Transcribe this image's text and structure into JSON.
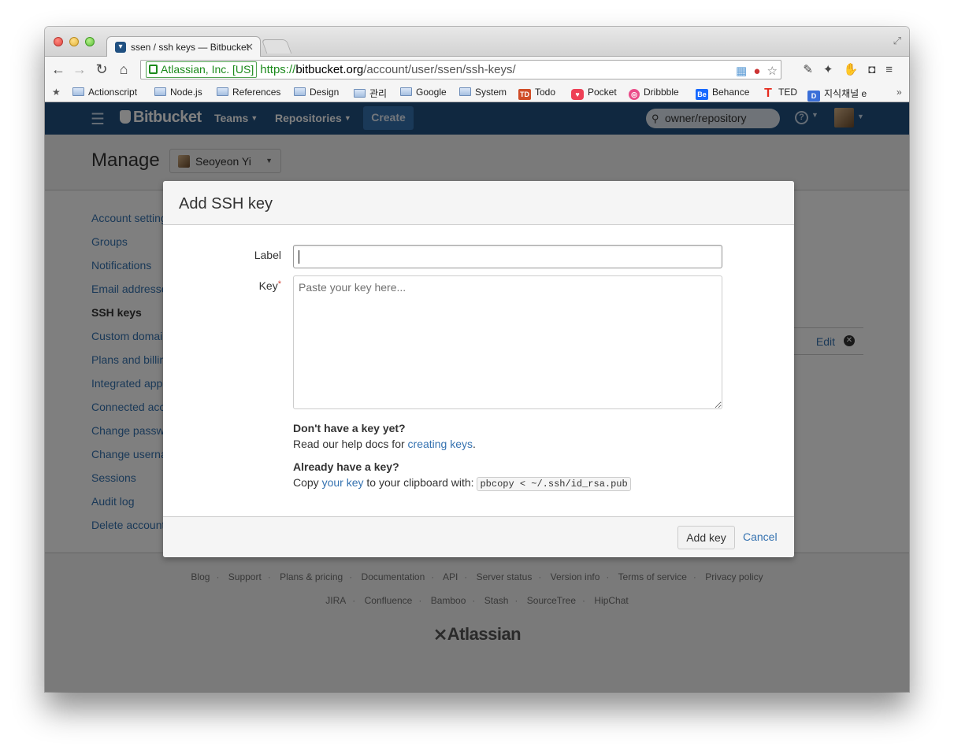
{
  "browser": {
    "tab_title": "ssen / ssh keys — Bitbucket",
    "ev_org": "Atlassian, Inc. [US]",
    "url_scheme": "https://",
    "url_host": "bitbucket.org",
    "url_path": "/account/user/ssen/ssh-keys/",
    "bookmarks": [
      {
        "label": "Actionscript",
        "icon": "folder-icon"
      },
      {
        "label": "Node.js",
        "icon": "folder-icon"
      },
      {
        "label": "References",
        "icon": "folder-icon"
      },
      {
        "label": "Design",
        "icon": "folder-icon"
      },
      {
        "label": "관리",
        "icon": "folder-icon"
      },
      {
        "label": "Google",
        "icon": "folder-icon"
      },
      {
        "label": "System",
        "icon": "folder-icon"
      },
      {
        "label": "Todo",
        "icon": "todo-icon"
      },
      {
        "label": "Pocket",
        "icon": "pocket-icon"
      },
      {
        "label": "Dribbble",
        "icon": "dribbble-icon"
      },
      {
        "label": "Behance",
        "icon": "behance-icon"
      },
      {
        "label": "TED",
        "icon": "ted-icon"
      },
      {
        "label": "지식채널 e",
        "icon": "channel-icon"
      }
    ],
    "bookmarks_more": "»"
  },
  "header": {
    "logo": "Bitbucket",
    "nav": [
      {
        "label": "Teams"
      },
      {
        "label": "Repositories"
      }
    ],
    "create_label": "Create",
    "search_placeholder": "owner/repository",
    "help_glyph": "?"
  },
  "manage": {
    "title": "Manage",
    "user": "Seoyeon Yi"
  },
  "sidebar": {
    "items": [
      {
        "label": "Account settings",
        "active": false
      },
      {
        "label": "Groups",
        "active": false
      },
      {
        "label": "Notifications",
        "active": false
      },
      {
        "label": "Email addresses",
        "active": false
      },
      {
        "label": "SSH keys",
        "active": true
      },
      {
        "label": "Custom domains",
        "active": false
      },
      {
        "label": "Plans and billing",
        "active": false
      },
      {
        "label": "Integrated applications",
        "active": false
      },
      {
        "label": "Connected accounts",
        "active": false
      },
      {
        "label": "Change password",
        "active": false
      },
      {
        "label": "Change username",
        "active": false
      },
      {
        "label": "Sessions",
        "active": false
      },
      {
        "label": "Audit log",
        "active": false
      },
      {
        "label": "Delete account",
        "active": false
      }
    ]
  },
  "keys_row": {
    "edit_label": "Edit"
  },
  "dialog": {
    "title": "Add SSH key",
    "label_field": {
      "label": "Label",
      "value": ""
    },
    "key_field": {
      "label": "Key",
      "required_mark": "*",
      "placeholder": "Paste your key here..."
    },
    "no_key_heading": "Don't have a key yet?",
    "no_key_text_pre": "Read our help docs for ",
    "no_key_link": "creating keys",
    "no_key_text_post": ".",
    "have_key_heading": "Already have a key?",
    "have_key_pre": "Copy ",
    "have_key_link": "your key",
    "have_key_mid": " to your clipboard with: ",
    "have_key_cmd": "pbcopy < ~/.ssh/id_rsa.pub",
    "add_button": "Add key",
    "cancel_link": "Cancel"
  },
  "footer": {
    "row1": [
      "Blog",
      "Support",
      "Plans & pricing",
      "Documentation",
      "API",
      "Server status",
      "Version info",
      "Terms of service",
      "Privacy policy"
    ],
    "row2": [
      "JIRA",
      "Confluence",
      "Bamboo",
      "Stash",
      "SourceTree",
      "HipChat"
    ],
    "logo": "Atlassian"
  },
  "colors": {
    "header_bg": "#205081",
    "link": "#3572b0",
    "create_bg": "#3572b0",
    "required": "#d04437"
  }
}
